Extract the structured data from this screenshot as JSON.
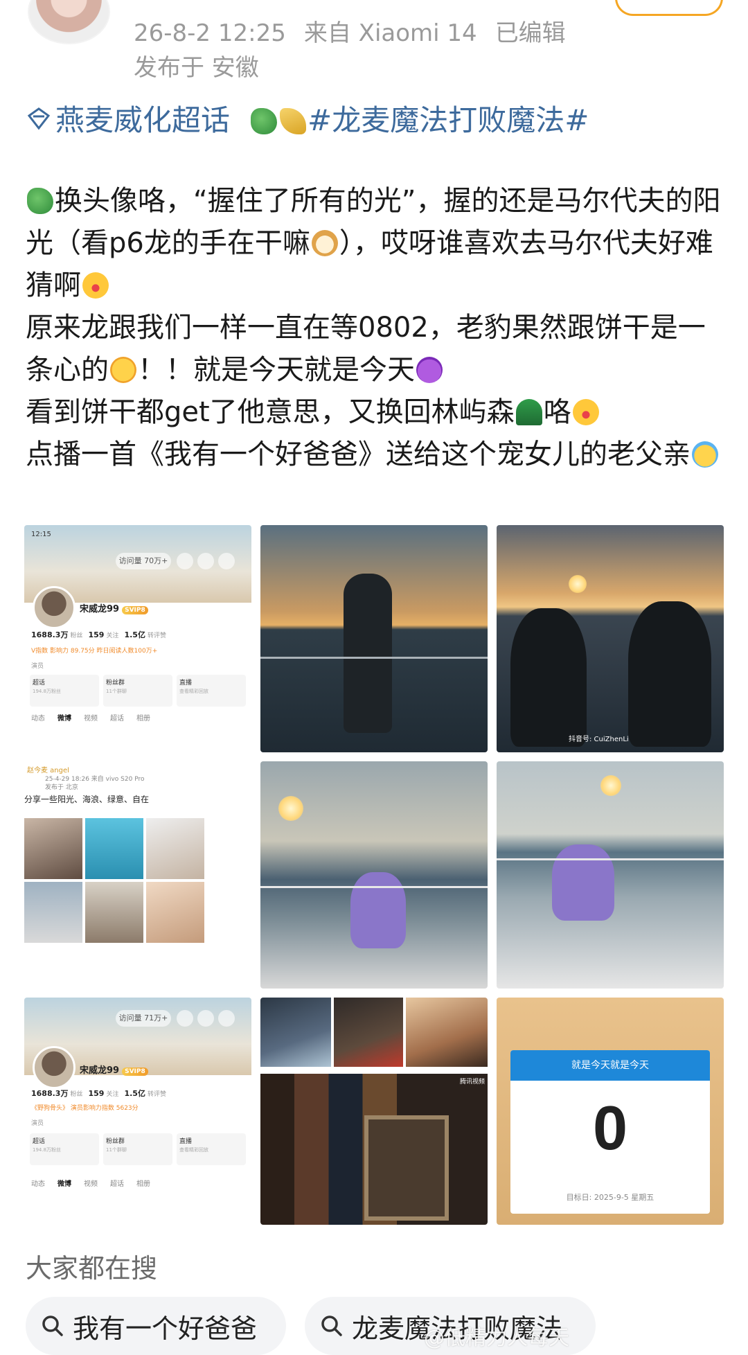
{
  "post_meta": {
    "datetime": "26-8-2 12:25",
    "source": "来自 Xiaomi 14",
    "edited": "已编辑",
    "location": "发布于 安徽"
  },
  "topics": {
    "super_topic": "燕麦威化超话",
    "hashtag": "#龙麦魔法打败魔法#"
  },
  "post_text": {
    "line1a": "换头像咯，“握住了所有的光”，握的还是马尔代夫的阳光（看p6龙的手在干嘛",
    "line1b": "），哎呀谁喜欢去马尔代夫好难猜啊",
    "line2a": "原来龙跟我们一样一直在等0802，老豹果然跟饼干是一条心的",
    "line2b": "！！就是今天就是今天",
    "line3a": "看到饼干都get了他意思，又换回林屿森",
    "line3b": "咯",
    "line4": "点播一首《我有一个好爸爸》送给这个宠女儿的老父亲"
  },
  "images": {
    "profile_a": {
      "status_time": "12:15",
      "visits": "访问量 70万+",
      "name": "宋威龙99",
      "vip": "SVIP8",
      "fans_num": "1688.3万",
      "fans_label": "粉丝",
      "follow_num": "159",
      "follow_label": "关注",
      "likes_num": "1.5亿",
      "likes_label": "转评赞",
      "tag1": "V指数 影响力 89.75分",
      "tag2": "昨日阅读人数100万+",
      "role": "演员",
      "card1": "超话",
      "card1_sub": "194.8万粉丝",
      "card2": "粉丝群",
      "card2_sub": "11个群聊",
      "card3": "直播",
      "card3_sub": "查看精彩回放",
      "tabs": [
        "动态",
        "微博",
        "视频",
        "超话",
        "相册"
      ]
    },
    "sunset_b_watermark": "抖音号: CuiZhenLi",
    "post_d": {
      "user": "赵今麦 angel",
      "device": "25-4-29 18:26 来自 vivo S20 Pro",
      "loc": "发布于 北京",
      "text": "分享一些阳光、海浪、绿意、自在"
    },
    "profile_g": {
      "visits": "访问量 71万+",
      "name": "宋威龙99",
      "vip": "SVIP8",
      "fans_num": "1688.3万",
      "fans_label": "粉丝",
      "follow_num": "159",
      "follow_label": "关注",
      "likes_num": "1.5亿",
      "likes_label": "转评赞",
      "tag1": "《野狗骨头》",
      "tag2": "演员影响力指数 5623分",
      "role": "演员",
      "card1": "超话",
      "card1_sub": "194.8万粉丝",
      "card2": "粉丝群",
      "card2_sub": "11个群聊",
      "card3": "直播",
      "card3_sub": "查看精彩回放",
      "tabs": [
        "动态",
        "微博",
        "视频",
        "超话",
        "相册"
      ]
    },
    "collage_watermark": "腾讯视频",
    "countdown": {
      "title": "就是今天就是今天",
      "value": "0",
      "target": "目标日: 2025-9-5 星期五"
    }
  },
  "search": {
    "title": "大家都在搜",
    "chips": [
      "我有一个好爸爸",
      "龙麦魔法打败魔法"
    ]
  },
  "watermark": "@低精力人每天"
}
